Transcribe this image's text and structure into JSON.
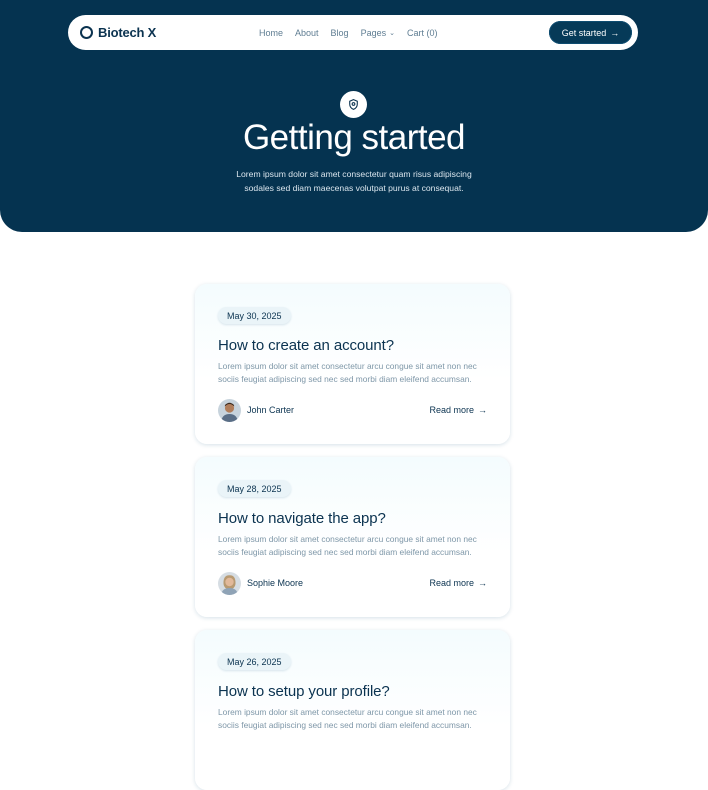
{
  "nav": {
    "brand": "Biotech X",
    "items": [
      {
        "label": "Home"
      },
      {
        "label": "About"
      },
      {
        "label": "Blog"
      },
      {
        "label": "Pages"
      },
      {
        "label": "Cart (0)"
      }
    ],
    "cta_label": "Get started",
    "chevron_icon": "chevron-down-icon",
    "arrow_icon": "arrow-right-icon"
  },
  "hero": {
    "icon": "shield-icon",
    "title": "Getting started",
    "subtitle": "Lorem ipsum dolor sit amet consectetur quam risus adipiscing sodales sed diam maecenas volutpat purus at consequat."
  },
  "posts": [
    {
      "date": "May 30, 2025",
      "title": "How to create an account?",
      "excerpt": "Lorem ipsum dolor sit amet consectetur arcu congue sit amet non nec sociis feugiat adipiscing sed nec sed morbi diam eleifend accumsan.",
      "author": "John Carter",
      "read_more": "Read more"
    },
    {
      "date": "May 28, 2025",
      "title": "How to navigate the app?",
      "excerpt": "Lorem ipsum dolor sit amet consectetur arcu congue sit amet non nec sociis feugiat adipiscing sed nec sed morbi diam eleifend accumsan.",
      "author": "Sophie Moore",
      "read_more": "Read more"
    },
    {
      "date": "May 26, 2025",
      "title": "How to setup your profile?",
      "excerpt": "Lorem ipsum dolor sit amet consectetur arcu congue sit amet non nec sociis feugiat adipiscing sed nec sed morbi diam eleifend accumsan.",
      "author": "",
      "read_more": ""
    }
  ],
  "colors": {
    "hero_bg": "#053350",
    "text_dark": "#0b3350",
    "text_muted": "#7e97a8",
    "nav_link": "#5f7d92"
  }
}
